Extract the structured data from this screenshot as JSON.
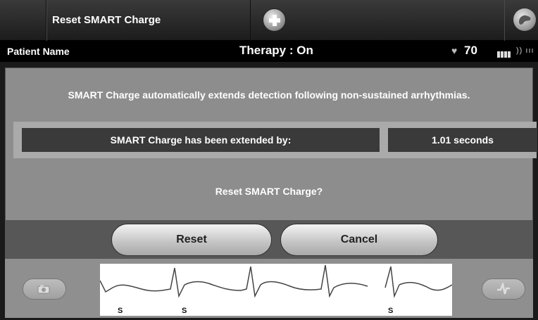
{
  "header": {
    "title": "Reset SMART Charge",
    "add_icon": "plus-circle-icon",
    "hand_icon": "hand-icon"
  },
  "status": {
    "patient_name": "Patient Name",
    "therapy": "Therapy : On",
    "heart_rate": "70",
    "heart_icon": "heart-icon",
    "battery_icon": "battery-icon",
    "signal_icon": "telemetry-signal-icon"
  },
  "dialog": {
    "message": "SMART Charge automatically extends detection following non-sustained arrhythmias.",
    "extend_label": "SMART Charge has been extended by:",
    "extend_value": "1.01 seconds",
    "question": "Reset SMART Charge?"
  },
  "buttons": {
    "reset": "Reset",
    "cancel": "Cancel"
  },
  "ecg": {
    "beat_markers": [
      "S",
      "S",
      "S"
    ],
    "left_button_icon": "camera-icon",
    "right_button_icon": "shock-icon"
  }
}
